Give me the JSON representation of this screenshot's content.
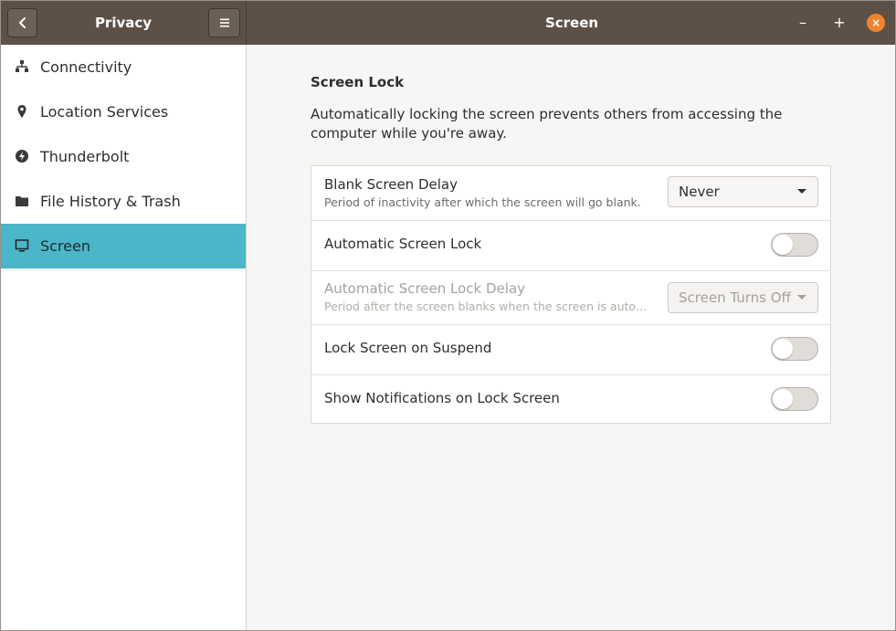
{
  "header": {
    "sidebar_title": "Privacy",
    "main_title": "Screen",
    "minimize_label": "–",
    "maximize_label": "+",
    "close_label": "×"
  },
  "sidebar": {
    "items": [
      {
        "label": "Connectivity",
        "icon": "network-icon",
        "active": false
      },
      {
        "label": "Location Services",
        "icon": "location-pin-icon",
        "active": false
      },
      {
        "label": "Thunderbolt",
        "icon": "thunderbolt-icon",
        "active": false
      },
      {
        "label": "File History & Trash",
        "icon": "folder-icon",
        "active": false
      },
      {
        "label": "Screen",
        "icon": "monitor-icon",
        "active": true
      }
    ]
  },
  "main": {
    "section_title": "Screen Lock",
    "section_description": "Automatically locking the screen prevents others from accessing the computer while you're away.",
    "rows": {
      "blank_delay": {
        "title": "Blank Screen Delay",
        "subtitle": "Period of inactivity after which the screen will go blank.",
        "value": "Never"
      },
      "auto_lock": {
        "title": "Automatic Screen Lock",
        "enabled": false
      },
      "auto_lock_delay": {
        "title": "Automatic Screen Lock Delay",
        "subtitle": "Period after the screen blanks when the screen is auto…",
        "value": "Screen Turns Off",
        "disabled": true
      },
      "lock_on_suspend": {
        "title": "Lock Screen on Suspend",
        "enabled": false
      },
      "show_notifications": {
        "title": "Show Notifications on Lock Screen",
        "enabled": false
      }
    }
  },
  "colors": {
    "headerbar": "#5d5147",
    "accent_selected": "#4bb6c7",
    "close_button": "#f0832f"
  }
}
